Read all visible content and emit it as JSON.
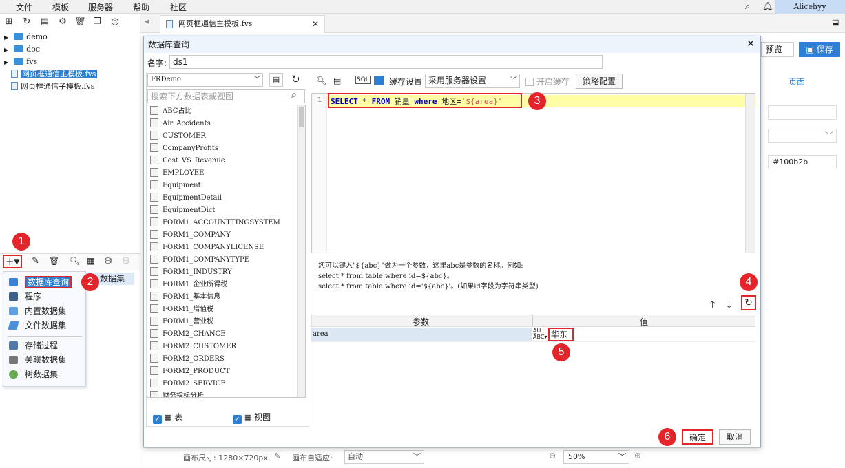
{
  "menubar": {
    "items": [
      "文件",
      "模板",
      "服务器",
      "帮助",
      "社区"
    ],
    "user": "Alicehyy"
  },
  "tree": {
    "items": [
      "demo",
      "doc",
      "fvs",
      "网页框通信主模板.fvs",
      "网页框通信子模板.fvs"
    ]
  },
  "tab": {
    "label": "网页框通信主模板.fvs"
  },
  "right": {
    "preview": "预览",
    "save": "保存",
    "page_link": "页面",
    "color_value": "#100b2b"
  },
  "dialog": {
    "title": "数据库查询",
    "name_label": "名字:",
    "name_value": "ds1",
    "connection": "FRDemo",
    "search_placeholder": "搜索下方数据表或视图",
    "tables": [
      "ABC占比",
      "Air_Accidents",
      "CUSTOMER",
      "CompanyProfits",
      "Cost_VS_Revenue",
      "EMPLOYEE",
      "Equipment",
      "EquipmentDetail",
      "EquipmentDict",
      "FORM1_ACCOUNTTINGSYSTEM",
      "FORM1_COMPANY",
      "FORM1_COMPANYLICENSE",
      "FORM1_COMPANYTYPE",
      "FORM1_INDUSTRY",
      "FORM1_企业所得税",
      "FORM1_基本信息",
      "FORM1_增值税",
      "FORM1_营业税",
      "FORM2_CHANCE",
      "FORM2_CUSTOMER",
      "FORM2_ORDERS",
      "FORM2_PRODUCT",
      "FORM2_SERVICE",
      "财务指标分析"
    ],
    "check_table": "表",
    "check_view": "视图",
    "cache_label": "缓存设置",
    "cache_value": "采用服务器设置",
    "enable_cache": "开启缓存",
    "strategy": "策略配置",
    "line_no": "1",
    "sql": {
      "kw1": "SELECT",
      "star": "*",
      "kw2": "FROM",
      "table": "销量",
      "kw3": "where",
      "field": "地区=",
      "str": "'${area}'"
    },
    "help": [
      "您可以键入\"${abc}\"做为一个参数，这里abc是参数的名称。例如:",
      "select * from table where id=${abc}。",
      "select * from table where id='${abc}'。(如果id字段为字符串类型)"
    ],
    "param_header": "参数",
    "value_header": "值",
    "param_name": "area",
    "param_value": "华东",
    "ok": "确定",
    "cancel": "取消"
  },
  "context_menu": {
    "items": [
      "数据库查询",
      "程序",
      "内置数据集",
      "文件数据集",
      "存储过程",
      "关联数据集",
      "树数据集"
    ],
    "behind": "数据集"
  },
  "badges": [
    "1",
    "2",
    "3",
    "4",
    "5",
    "6"
  ],
  "bottom": {
    "canvas_size": "画布尺寸: 1280×720px",
    "adapt_label": "画布自适应:",
    "adapt_value": "自动",
    "zoom": "50%"
  }
}
